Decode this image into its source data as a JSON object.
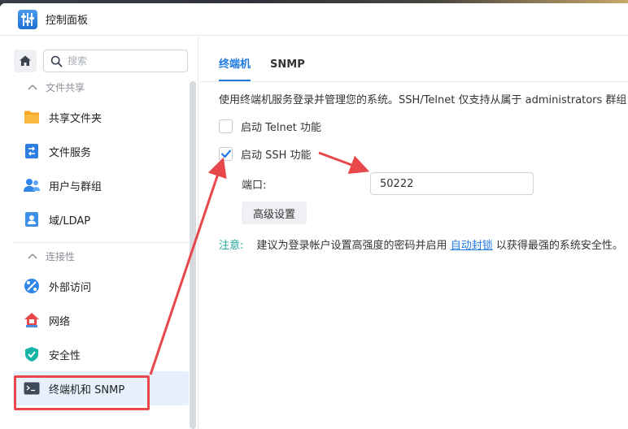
{
  "window": {
    "title": "控制面板"
  },
  "sidebar": {
    "search_placeholder": "搜索",
    "sections": [
      {
        "header": "文件共享",
        "items": [
          {
            "label": "共享文件夹",
            "icon": "folder-icon"
          },
          {
            "label": "文件服务",
            "icon": "file-services-icon"
          },
          {
            "label": "用户与群组",
            "icon": "users-icon"
          },
          {
            "label": "域/LDAP",
            "icon": "domain-icon"
          }
        ]
      },
      {
        "header": "连接性",
        "items": [
          {
            "label": "外部访问",
            "icon": "external-access-icon"
          },
          {
            "label": "网络",
            "icon": "network-icon"
          },
          {
            "label": "安全性",
            "icon": "shield-icon"
          },
          {
            "label": "终端机和 SNMP",
            "icon": "terminal-icon",
            "active": true
          }
        ]
      }
    ]
  },
  "tabs": [
    {
      "label": "终端机",
      "active": true
    },
    {
      "label": "SNMP",
      "active": false
    }
  ],
  "terminal": {
    "description": "使用终端机服务登录并管理您的系统。SSH/Telnet 仅支持从属于 administrators 群组",
    "telnet_label": "启动 Telnet 功能",
    "telnet_checked": false,
    "ssh_label": "启动 SSH 功能",
    "ssh_checked": true,
    "port_label": "端口:",
    "port_value": "50222",
    "advanced_button": "高级设置",
    "note_label": "注意:",
    "note_text_before": "建议为登录帐户设置高强度的密码并启用",
    "note_link": "自动封锁",
    "note_text_after": "以获得最强的系统安全性。"
  },
  "colors": {
    "accent": "#1f7ae0",
    "note": "#1fa39a",
    "annotation": "#e8484a",
    "active_item_bg": "#e6f1fd"
  }
}
